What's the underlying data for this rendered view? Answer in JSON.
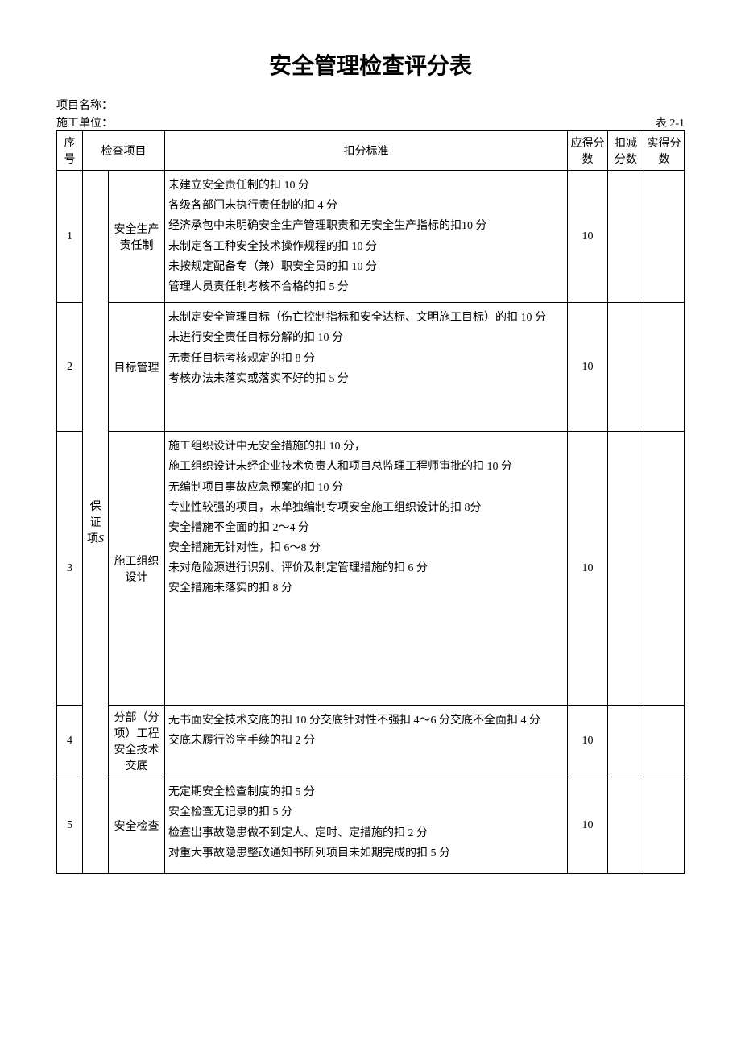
{
  "title": "安全管理检查评分表",
  "project_label": "项目名称：",
  "unit_label": "施工单位：",
  "table_number": "表 2-1",
  "headers": {
    "seq": "序号",
    "item": "检查项目",
    "criteria": "扣分标准",
    "max_score": "应得分数",
    "deduct": "扣减分数",
    "actual": "实得分数"
  },
  "group_label_prefix": "保证项",
  "group_label_suffix": "S",
  "rows": [
    {
      "seq": "1",
      "item": "安全生产责任制",
      "criteria": "未建立安全责任制的扣 10 分\n各级各部门未执行责任制的扣 4 分\n经济承包中未明确安全生产管理职责和无安全生产指标的扣10 分\n未制定各工种安全技术操作规程的扣 10 分\n未按规定配备专（兼）职安全员的扣 10 分\n管理人员责任制考核不合格的扣 5 分",
      "max_score": "10"
    },
    {
      "seq": "2",
      "item": "目标管理",
      "criteria": "未制定安全管理目标（伤亡控制指标和安全达标、文明施工目标）的扣 10 分\n未进行安全责任目标分解的扣 10 分\n无责任目标考核规定的扣 8 分\n考核办法未落实或落实不好的扣 5 分",
      "max_score": "10"
    },
    {
      "seq": "3",
      "item": "施工组织设计",
      "criteria": "施工组织设计中无安全措施的扣 10 分，\n施工组织设计未经企业技术负责人和项目总监理工程师审批的扣 10 分\n无编制项目事故应急预案的扣 10 分\n专业性较强的项目，未单独编制专项安全施工组织设计的扣 8分\n安全措施不全面的扣 2～4 分\n安全措施无针对性，扣 6～8 分\n未对危险源进行识别、评价及制定管理措施的扣 6 分\n安全措施未落实的扣 8 分",
      "max_score": "10"
    },
    {
      "seq": "4",
      "item": "分部（分项）工程安全技术交底",
      "criteria": "无书面安全技术交底的扣 10 分交底针对性不强扣 4～6 分交底不全面扣 4 分\n交底未履行签字手续的扣 2 分",
      "max_score": "10"
    },
    {
      "seq": "5",
      "item": "安全检查",
      "criteria": "无定期安全检查制度的扣 5 分\n安全检查无记录的扣 5 分\n检查出事故隐患做不到定人、定时、定措施的扣 2 分\n对重大事故隐患整改通知书所列项目未如期完成的扣 5 分",
      "max_score": "10"
    }
  ]
}
